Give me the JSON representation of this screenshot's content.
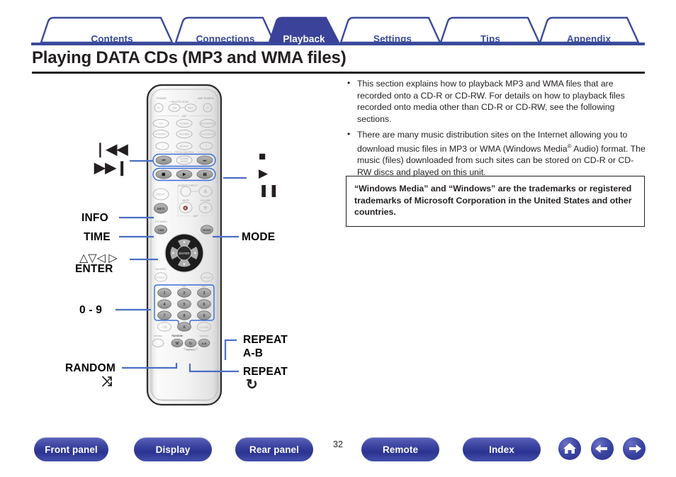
{
  "tabs": [
    {
      "label": "Contents",
      "active": false,
      "name": "tab-contents"
    },
    {
      "label": "Connections",
      "active": false,
      "name": "tab-connections"
    },
    {
      "label": "Playback",
      "active": true,
      "name": "tab-playback"
    },
    {
      "label": "Settings",
      "active": false,
      "name": "tab-settings"
    },
    {
      "label": "Tips",
      "active": false,
      "name": "tab-tips"
    },
    {
      "label": "Appendix",
      "active": false,
      "name": "tab-appendix"
    }
  ],
  "page": {
    "title": "Playing DATA CDs (MP3 and WMA files)",
    "number": "32"
  },
  "body": {
    "bullet1": "This section explains how to playback MP3 and WMA files that are recorded onto a CD-R or CD-RW. For details on how to playback files recorded onto media other than CD-R or CD-RW, see the following sections.",
    "bullet2_part1": "There are many music distribution sites on the Internet allowing you to download music files in MP3 or WMA (Windows Media",
    "bullet2_sup": "®",
    "bullet2_part2": " Audio) format. The music (files) downloaded from such sites can be stored on CD-R or CD-RW discs and played on this unit.",
    "notice": "“Windows Media” and “Windows” are the trademarks or registered trademarks of Microsoft Corporation in the United States and other countries."
  },
  "callouts": {
    "skip_back": "❘◀◀",
    "skip_forward": "▶▶❙",
    "info": "INFO",
    "time": "TIME",
    "cursor": "△▽◁ ▷",
    "enter": "ENTER",
    "numbers": "0 - 9",
    "random": "RANDOM",
    "random_glyph": "⤨",
    "mode": "MODE",
    "repeat_ab_line1": "REPEAT",
    "repeat_ab_line2": "A-B",
    "repeat": "REPEAT",
    "repeat_glyph": "↻"
  },
  "remote": {
    "top_labels": {
      "power": "POWER",
      "amp_power": "AMP POWER",
      "remote_mode": "REMOTE MODE",
      "mode_cd": "CD",
      "mode_net": "NET",
      "amp": "AMP",
      "pitch_control": "PITCH CONTROL",
      "reset": "RESET",
      "minus": "−",
      "plus": "+"
    },
    "source_buttons": [
      "CD",
      "TUNER",
      "NETWORK",
      "PHONO",
      "AUX/BD",
      "AUX/DVD"
    ],
    "transport": {
      "prev": "◀◀",
      "sound_mode_line1": "SOUND",
      "sound_mode_line2": "MODE",
      "next": "▶▶",
      "stop": "■",
      "play": "▶",
      "pause": "■"
    },
    "mid_labels": {
      "input": "INPUT",
      "source_direct": "SOURCE DIRECT",
      "mute": "MUTE",
      "volume": "VOLUME",
      "amp": "AMP",
      "info": "INFO",
      "top_menu": "TOP MENU",
      "time": "TIME",
      "mode": "MODE",
      "enter": "ENTER",
      "favorite": "FAVORITE",
      "prog": "PROG",
      "setup": "SETUP"
    },
    "keypad": {
      "keys": [
        "1",
        "2",
        "3",
        "4",
        "5",
        "6",
        "7",
        "8",
        "9"
      ],
      "sub_labels": [
        "ABC",
        "DEF",
        "GHI",
        "JKL",
        "MNO",
        "PQRS",
        "TUV",
        "WXYZ"
      ],
      "plus10": "+10",
      "zero": "0",
      "clear": "CLEAR"
    },
    "bottom_labels": {
      "dimmer": "DIMMER",
      "random": "RANDOM",
      "repeat": "REPEAT",
      "search": "SEARCH",
      "ab": "A-B"
    }
  },
  "footer": {
    "buttons": [
      {
        "label": "Front panel",
        "name": "footer-front-panel"
      },
      {
        "label": "Display",
        "name": "footer-display"
      },
      {
        "label": "Rear panel",
        "name": "footer-rear-panel"
      },
      {
        "label": "Remote",
        "name": "footer-remote"
      },
      {
        "label": "Index",
        "name": "footer-index"
      }
    ],
    "icons": [
      {
        "name": "home-icon"
      },
      {
        "name": "back-arrow-icon"
      },
      {
        "name": "forward-arrow-icon"
      }
    ]
  },
  "colors": {
    "brand_blue": "#3a4a9b",
    "active_tab": "#3a4399",
    "leader_line": "#4a6fc4",
    "text": "#231f20"
  }
}
